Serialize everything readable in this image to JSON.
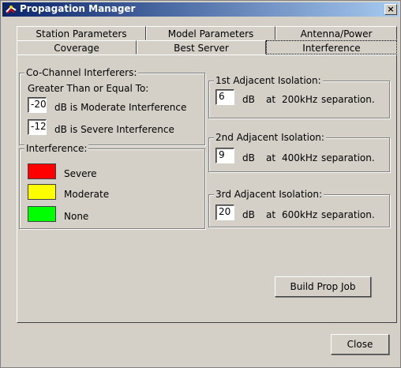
{
  "window": {
    "title": "Propagation Manager",
    "close_glyph": "×"
  },
  "tabs": {
    "row1": [
      {
        "label": "Station Parameters"
      },
      {
        "label": "Model Parameters"
      },
      {
        "label": "Antenna/Power"
      }
    ],
    "row2": [
      {
        "label": "Coverage"
      },
      {
        "label": "Best Server"
      },
      {
        "label": "Interference"
      }
    ],
    "active": "Interference"
  },
  "co_channel": {
    "title": "Co-Channel Interferers:",
    "subtitle": "Greater Than or Equal To:",
    "moderate_value": "-20",
    "moderate_label": "dB is Moderate Interference",
    "severe_value": "-12",
    "severe_label": "dB is Severe Interference"
  },
  "interference_legend": {
    "title": "Interference:",
    "items": [
      {
        "label": "Severe",
        "color": "#ff0000"
      },
      {
        "label": "Moderate",
        "color": "#ffff00"
      },
      {
        "label": "None",
        "color": "#00ff00"
      }
    ]
  },
  "adjacent": [
    {
      "title": "1st Adjacent Isolation:",
      "value": "6",
      "db": "dB",
      "at": "at",
      "freq": "200kHz",
      "sep": "separation."
    },
    {
      "title": "2nd Adjacent Isolation:",
      "value": "9",
      "db": "dB",
      "at": "at",
      "freq": "400kHz",
      "sep": "separation."
    },
    {
      "title": "3rd Adjacent Isolation:",
      "value": "20",
      "db": "dB",
      "at": "at",
      "freq": "600kHz",
      "sep": "separation."
    }
  ],
  "buttons": {
    "build_prop_job": "Build Prop Job",
    "close": "Close"
  },
  "icons": {
    "app": "propagation-app-icon",
    "close": "close-icon"
  }
}
